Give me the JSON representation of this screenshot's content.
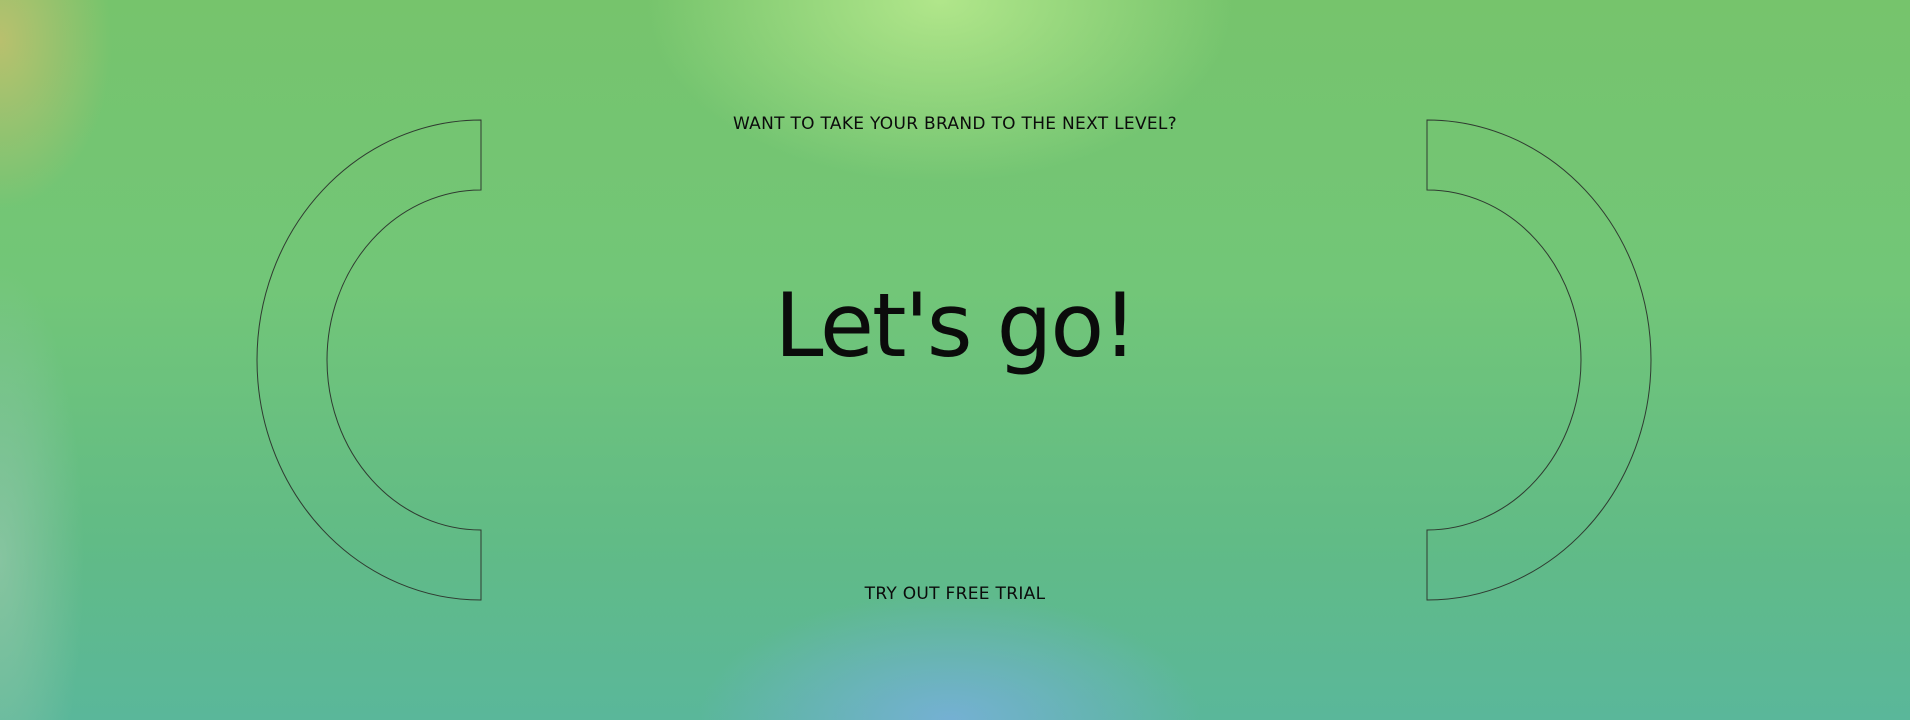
{
  "hero": {
    "eyebrow": "WANT TO TAKE YOUR BRAND TO THE NEXT LEVEL?",
    "headline": "Let's go!",
    "cta_label": "TRY OUT FREE TRIAL"
  },
  "colors": {
    "text": "#0b0b0b",
    "background_base": "#72c678",
    "background_top_glow": "#b4e88c",
    "background_bottom_glow": "#76b0d6",
    "outline": "#2f3a30"
  },
  "decorations": {
    "left_shape": "left-bracket-arc",
    "right_shape": "right-bracket-arc"
  }
}
